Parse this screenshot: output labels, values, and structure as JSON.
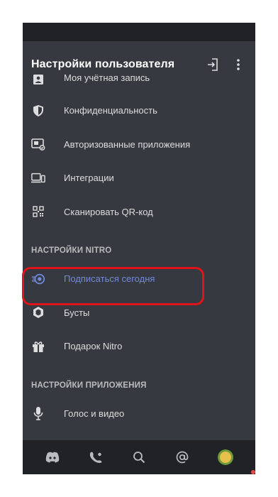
{
  "header": {
    "title": "Настройки пользователя"
  },
  "account_section": {
    "items": [
      {
        "label": "Моя учётная запись",
        "icon": "account-card-icon"
      },
      {
        "label": "Конфиденциальность",
        "icon": "shield-icon"
      },
      {
        "label": "Авторизованные приложения",
        "icon": "authorized-apps-icon"
      },
      {
        "label": "Интеграции",
        "icon": "integrations-icon"
      },
      {
        "label": "Сканировать QR-код",
        "icon": "qr-code-icon"
      }
    ]
  },
  "nitro_section": {
    "title": "НАСТРОЙКИ NITRO",
    "items": [
      {
        "label": "Подписаться сегодня",
        "icon": "nitro-icon",
        "highlighted": true
      },
      {
        "label": "Бусты",
        "icon": "boost-icon"
      },
      {
        "label": "Подарок Nitro",
        "icon": "gift-icon"
      }
    ]
  },
  "app_section": {
    "title": "НАСТРОЙКИ ПРИЛОЖЕНИЯ",
    "items": [
      {
        "label": "Голос и видео",
        "icon": "microphone-icon"
      }
    ]
  },
  "bottom_nav": [
    "discord-home-icon",
    "friends-icon",
    "search-icon",
    "mentions-icon",
    "profile-avatar"
  ],
  "colors": {
    "background": "#36393f",
    "nav_background": "#202225",
    "accent": "#7289da",
    "highlight_outline": "#e0141b",
    "text": "#dcddde",
    "section_title": "#b9bbbe"
  }
}
